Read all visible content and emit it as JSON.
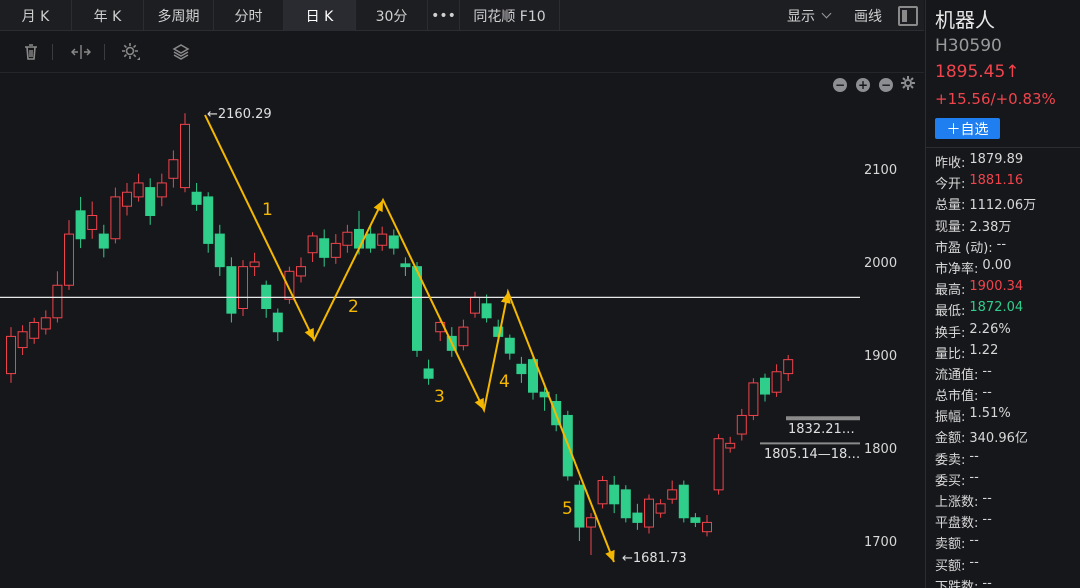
{
  "tabs": [
    {
      "id": "month",
      "label": "月 K",
      "w": 72
    },
    {
      "id": "year",
      "label": "年 K",
      "w": 72
    },
    {
      "id": "multi",
      "label": "多周期",
      "w": 70
    },
    {
      "id": "fenshi",
      "label": "分时",
      "w": 70
    },
    {
      "id": "day",
      "label": "日 K",
      "w": 72,
      "active": true
    },
    {
      "id": "30min",
      "label": "30分",
      "w": 72
    },
    {
      "id": "more",
      "label": "•••",
      "w": 32
    },
    {
      "id": "f10",
      "label": "同花顺 F10",
      "w": 100
    }
  ],
  "right_buttons": {
    "display": "显示",
    "draw": "画线"
  },
  "toolbar_icons": [
    "trash-icon",
    "split-icon",
    "gear-icon",
    "layers-icon"
  ],
  "stock": {
    "name": "机器人",
    "code": "H30590",
    "price": "1895.45↑",
    "change": "+15.56/+0.83%",
    "watch_label": "＋自选"
  },
  "stats": [
    {
      "k": "昨收:",
      "v": "1879.89"
    },
    {
      "k": "今开:",
      "v": "1881.16",
      "color": "red"
    },
    {
      "k": "总量:",
      "v": "1112.06万"
    },
    {
      "k": "现量:",
      "v": "2.38万"
    },
    {
      "k": "市盈 (动):",
      "v": "--"
    },
    {
      "k": "市净率:",
      "v": "0.00"
    },
    {
      "k": "最高:",
      "v": "1900.34",
      "color": "red"
    },
    {
      "k": "最低:",
      "v": "1872.04",
      "color": "green"
    },
    {
      "k": "换手:",
      "v": "2.26%"
    },
    {
      "k": "量比:",
      "v": "1.22"
    },
    {
      "k": "流通值:",
      "v": "--"
    },
    {
      "k": "总市值:",
      "v": "--"
    },
    {
      "k": "振幅:",
      "v": "1.51%"
    },
    {
      "k": "金额:",
      "v": "340.96亿"
    },
    {
      "k": "委卖:",
      "v": "--"
    },
    {
      "k": "委买:",
      "v": "--"
    },
    {
      "k": "上涨数:",
      "v": "--"
    },
    {
      "k": "平盘数:",
      "v": "--"
    },
    {
      "k": "卖额:",
      "v": "--"
    },
    {
      "k": "买额:",
      "v": "--"
    },
    {
      "k": "下跌数:",
      "v": "--"
    }
  ],
  "chart_data": {
    "type": "candlestick",
    "y_ticks": [
      1700,
      1800,
      1900,
      2000,
      2100
    ],
    "horizontal_line": 1962,
    "annotations": {
      "max": "←2160.29",
      "min": "←1681.73",
      "level1": "1832.21…",
      "level2": "1805.14—18…"
    },
    "wave_labels": [
      "1",
      "2",
      "3",
      "4",
      "5"
    ],
    "colors": {
      "up": "#f0444c",
      "down": "#2fce8a",
      "wave": "#f5b800",
      "bg": "#16171b"
    }
  }
}
